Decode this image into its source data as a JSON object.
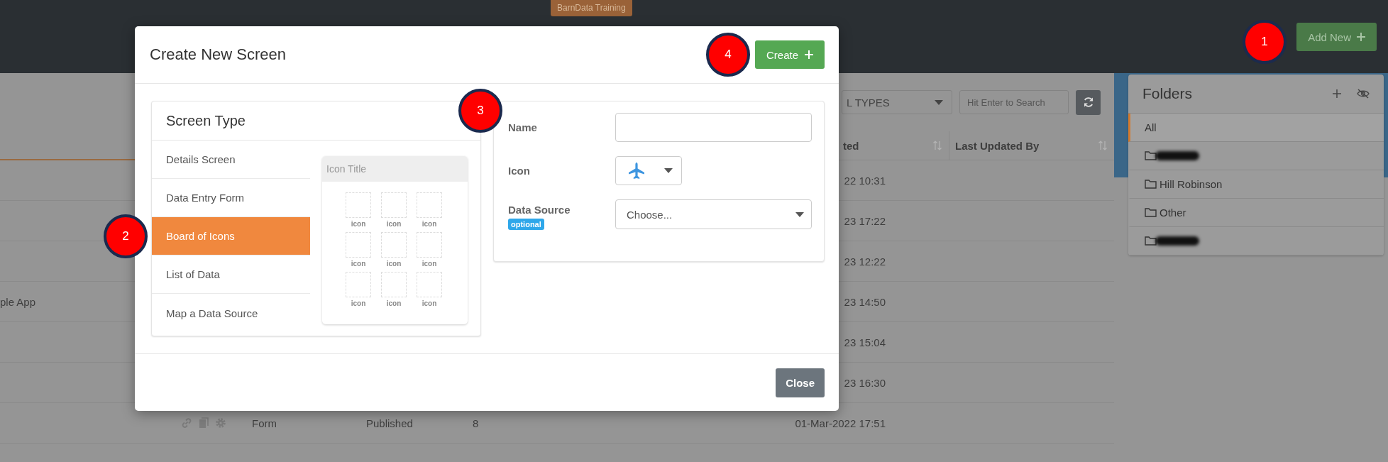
{
  "top_bar": {
    "badge": "BarnData Training",
    "add_button": "Add New"
  },
  "toolbar": {
    "type_filter": "L TYPES",
    "search": {
      "placeholder": "Hit Enter to Search"
    }
  },
  "table": {
    "columns": [
      "ted",
      "Last Updated By"
    ],
    "rows": [
      {
        "kind": "covered",
        "date": "22 10:31"
      },
      {
        "kind": "covered",
        "date": "23 17:22"
      },
      {
        "kind": "covered",
        "date": "23 12:22"
      },
      {
        "kind": "covered",
        "name": "ple App",
        "date": "23 14:50"
      },
      {
        "kind": "covered",
        "date": "23 15:04"
      },
      {
        "kind": "covered",
        "date": "23 16:30"
      },
      {
        "kind": "full",
        "type": "Form",
        "status": "Published",
        "count": "8",
        "date": "01-Mar-2022 17:51"
      }
    ]
  },
  "folders": {
    "title": "Folders",
    "items": [
      {
        "kind": "all",
        "label": "All",
        "selected": true
      },
      {
        "kind": "redacted",
        "selected": false
      },
      {
        "kind": "folder",
        "label": "Hill Robinson",
        "selected": false
      },
      {
        "kind": "folder",
        "label": "Other",
        "selected": false
      },
      {
        "kind": "redacted",
        "selected": false
      }
    ]
  },
  "modal": {
    "title": "Create New Screen",
    "create_button": "Create",
    "screen_type": {
      "title": "Screen Type",
      "options": [
        {
          "label": "Details Screen",
          "selected": false
        },
        {
          "label": "Data Entry Form",
          "selected": false
        },
        {
          "label": "Board of Icons",
          "selected": true
        },
        {
          "label": "List of Data",
          "selected": false
        },
        {
          "label": "Map a Data Source",
          "selected": false
        }
      ]
    },
    "preview": {
      "title": "Icon Title",
      "tiles": [
        "icon",
        "icon",
        "icon",
        "icon",
        "icon",
        "icon",
        "icon",
        "icon",
        "icon"
      ]
    },
    "form": {
      "name": {
        "label": "Name"
      },
      "icon": {
        "label": "Icon"
      },
      "data_source": {
        "label": "Data Source",
        "badge": "optional",
        "value": "Choose..."
      }
    },
    "close_button": "Close"
  },
  "annotations": [
    "1",
    "2",
    "3",
    "4"
  ]
}
